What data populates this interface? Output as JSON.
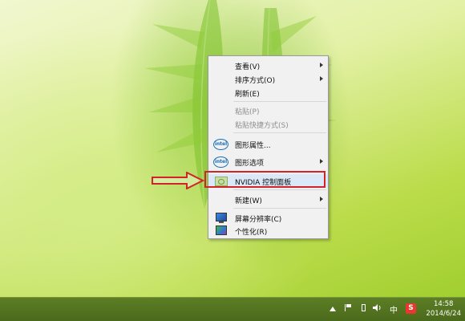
{
  "context_menu": {
    "items": [
      {
        "label": "查看(V)"
      },
      {
        "label": "排序方式(O)"
      },
      {
        "label": "刷新(E)"
      },
      {
        "label": "粘贴(P)"
      },
      {
        "label": "粘贴快捷方式(S)"
      },
      {
        "label": "图形属性..."
      },
      {
        "label": "图形选项"
      },
      {
        "label": "NVIDIA 控制面板"
      },
      {
        "label": "新建(W)"
      },
      {
        "label": "屏幕分辨率(C)"
      },
      {
        "label": "个性化(R)"
      }
    ],
    "highlighted_item": "NVIDIA 控制面板",
    "highlight_color": "#d1232a"
  },
  "icons": {
    "intel": "intel",
    "sogou": "S",
    "ime": "中"
  },
  "taskbar": {
    "time": "14:58",
    "date": "2014/6/24"
  }
}
